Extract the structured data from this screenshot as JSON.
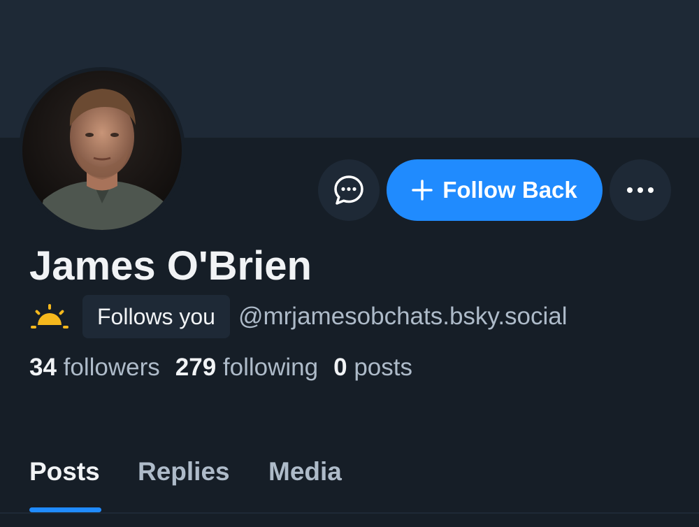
{
  "profile": {
    "display_name": "James O'Brien",
    "handle": "@mrjamesobchats.bsky.social",
    "follows_you_label": "Follows you"
  },
  "actions": {
    "chat_icon": "chat-bubble-icon",
    "follow_back_label": "Follow Back",
    "follow_icon": "plus-icon",
    "more_icon": "more-options-icon"
  },
  "stats": {
    "followers_count": "34",
    "followers_label": "followers",
    "following_count": "279",
    "following_label": "following",
    "posts_count": "0",
    "posts_label": "posts"
  },
  "tabs": [
    {
      "label": "Posts",
      "active": true
    },
    {
      "label": "Replies",
      "active": false
    },
    {
      "label": "Media",
      "active": false
    }
  ],
  "colors": {
    "accent": "#208bfe",
    "background": "#161e27",
    "banner": "#1e2936",
    "badge_icon": "#f5b81d"
  }
}
